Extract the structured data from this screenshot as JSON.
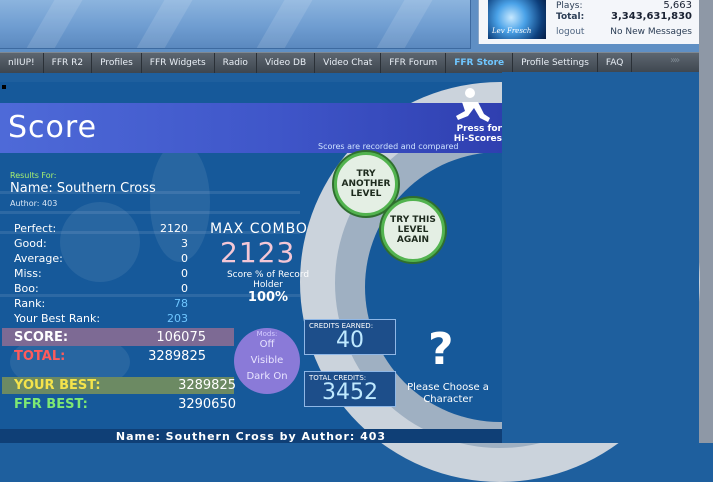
{
  "user_panel": {
    "avatar_text": "Lev Fresch",
    "plays_label": "Plays:",
    "plays_value": "5,663",
    "total_label": "Total:",
    "total_value": "3,343,631,830",
    "logout_label": "logout",
    "messages_text": "No New Messages"
  },
  "nav": {
    "items": [
      {
        "label": "nIIUP!"
      },
      {
        "label": "FFR R2"
      },
      {
        "label": "Profiles"
      },
      {
        "label": "FFR Widgets"
      },
      {
        "label": "Radio"
      },
      {
        "label": "Video DB"
      },
      {
        "label": "Video Chat"
      },
      {
        "label": "FFR Forum"
      },
      {
        "label": "FFR Store",
        "active": true
      },
      {
        "label": "Profile Settings"
      },
      {
        "label": "FAQ"
      }
    ],
    "arrows": "»»"
  },
  "banner": {
    "title": "Score",
    "note": "Scores are recorded and compared",
    "press_text": "Press for Hi-Scores"
  },
  "buttons": {
    "try_another": "TRY ANOTHER LEVEL",
    "try_again": "TRY THIS LEVEL AGAIN"
  },
  "results": {
    "results_for": "Results For:",
    "song_name": "Name: Southern Cross",
    "author": "Author: 403"
  },
  "stats": {
    "perfect_label": "Perfect:",
    "perfect_value": "2120",
    "good_label": "Good:",
    "good_value": "3",
    "average_label": "Average:",
    "average_value": "0",
    "miss_label": "Miss:",
    "miss_value": "0",
    "boo_label": "Boo:",
    "boo_value": "0",
    "rank_label": "Rank:",
    "rank_value": "78",
    "best_rank_label": "Your Best Rank:",
    "best_rank_value": "203"
  },
  "combo": {
    "max_combo_label": "MAX COMBO",
    "max_combo_value": "2123",
    "record_label": "Score % of Record Holder",
    "record_value": "100%"
  },
  "scores": {
    "score_label": "SCORE:",
    "score_value": "106075",
    "total_label": "TOTAL:",
    "total_value": "3289825",
    "your_best_label": "YOUR BEST:",
    "your_best_value": "3289825",
    "ffr_best_label": "FFR BEST:",
    "ffr_best_value": "3290650"
  },
  "mods": {
    "label": "Mods:",
    "items": [
      "Off",
      "Visible",
      "Dark On"
    ]
  },
  "credits": {
    "earned_label": "CREDITS EARNED:",
    "earned_value": "40",
    "total_label": "TOTAL CREDITS:",
    "total_value": "3452"
  },
  "character": {
    "icon": "?",
    "label": "Please Choose a Character"
  },
  "footer": {
    "text": "Name: Southern Cross by Author: 403"
  }
}
